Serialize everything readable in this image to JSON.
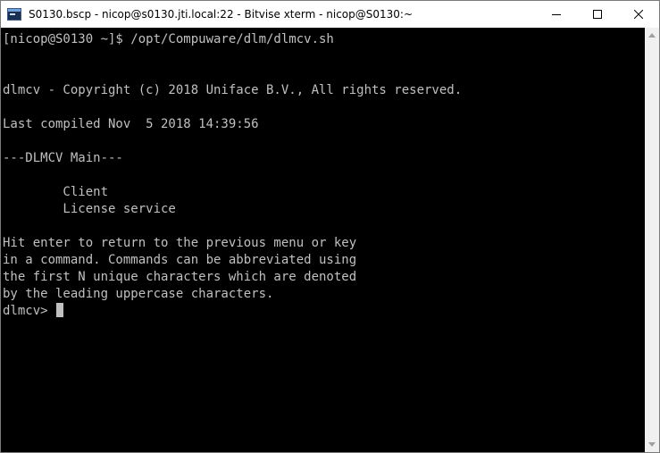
{
  "window": {
    "title": "S0130.bscp - nicop@s0130.jti.local:22 - Bitvise xterm - nicop@S0130:~",
    "icon": "bitvise-terminal-icon",
    "controls": {
      "minimize_icon": "minimize-icon",
      "maximize_icon": "maximize-icon",
      "close_icon": "close-icon"
    }
  },
  "terminal": {
    "background": "#000000",
    "foreground": "#c0c0c0",
    "lines": [
      "[nicop@S0130 ~]$ /opt/Compuware/dlm/dlmcv.sh",
      "",
      "",
      "dlmcv - Copyright (c) 2018 Uniface B.V., All rights reserved.",
      "",
      "Last compiled Nov  5 2018 14:39:56",
      "",
      "---DLMCV Main---",
      "",
      "        Client",
      "        License service",
      "",
      "Hit enter to return to the previous menu or key",
      "in a command. Commands can be abbreviated using",
      "the first N unique characters which are denoted",
      "by the leading uppercase characters."
    ],
    "prompt": "dlmcv> "
  }
}
